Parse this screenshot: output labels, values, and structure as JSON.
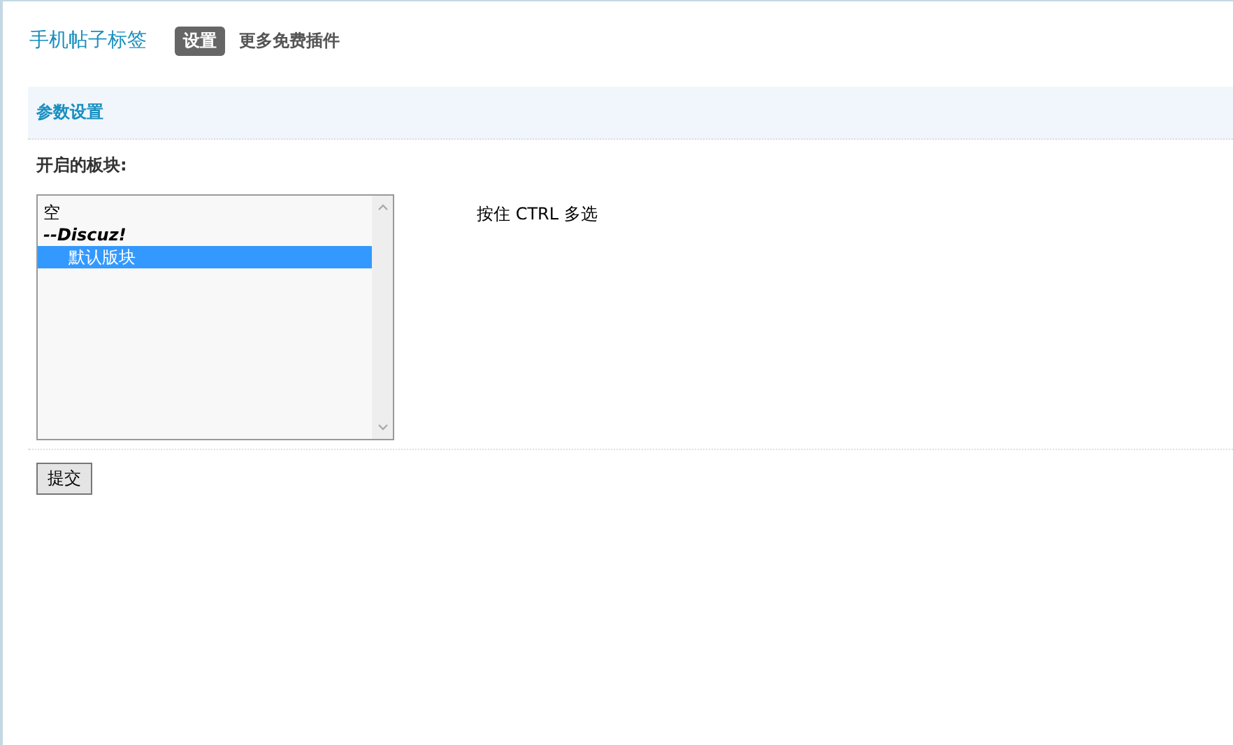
{
  "header": {
    "title": "手机帖子标签",
    "nav": [
      {
        "label": "设置",
        "selected": true
      },
      {
        "label": "更多免费插件",
        "selected": false
      }
    ]
  },
  "section": {
    "title": "参数设置"
  },
  "field": {
    "label": "开启的板块:",
    "options": [
      {
        "label": "空",
        "kind": "plain",
        "selected": false
      },
      {
        "label": "--Discuz!",
        "kind": "group",
        "selected": false
      },
      {
        "label": "默认版块",
        "kind": "child",
        "selected": true
      }
    ],
    "hint": "按住 CTRL 多选"
  },
  "submit": "提交"
}
